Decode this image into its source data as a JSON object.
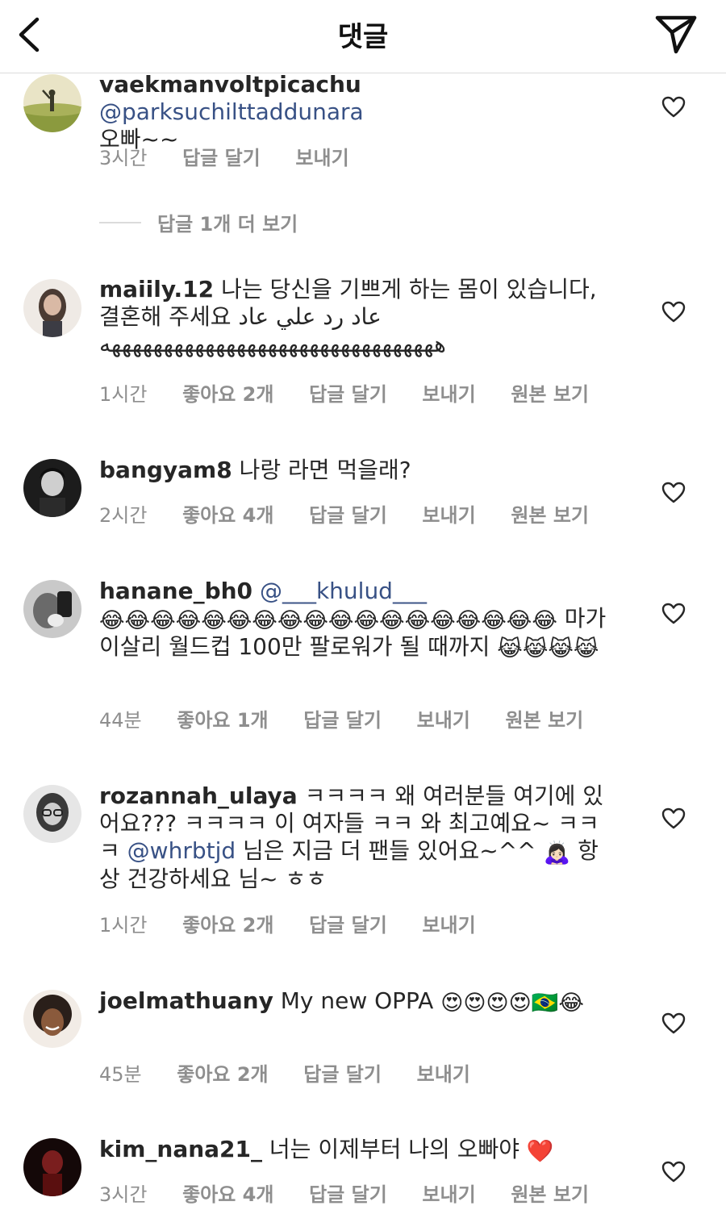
{
  "header": {
    "title": "댓글"
  },
  "comments": [
    {
      "username": "vaekmanvoltpicachu",
      "mention": "@parksuchilttaddunara",
      "text": "오빠~~",
      "meta": {
        "time": "3시간",
        "reply": "답글 달기",
        "send": "보내기"
      }
    },
    {
      "username": "maiily.12",
      "text": "나는 당신을 기쁘게 하는 몸이 있습니다, 결혼해 주세요 عاد رد علي عاد ههههههههههههههههههههههههههههههههه",
      "meta": {
        "time": "1시간",
        "likes": "좋아요 2개",
        "reply": "답글 달기",
        "send": "보내기",
        "original": "원본 보기"
      }
    },
    {
      "username": "bangyam8",
      "text": "나랑 라면 먹을래?",
      "meta": {
        "time": "2시간",
        "likes": "좋아요 4개",
        "reply": "답글 달기",
        "send": "보내기",
        "original": "원본 보기"
      }
    },
    {
      "username": "hanane_bh0",
      "mention": "@___khulud___",
      "emoji1": "😂😂😂😂😂😂😂😂😂😂😂😂😂😂😂😂😂😂",
      "text": "마가 이살리 월드컵 100만 팔로워가 될 때까지",
      "emoji2": "😹😹😹😹",
      "meta": {
        "time": "44분",
        "likes": "좋아요 1개",
        "reply": "답글 달기",
        "send": "보내기",
        "original": "원본 보기"
      }
    },
    {
      "username": "rozannah_ulaya",
      "text1": "ㅋㅋㅋㅋ 왜 여러분들 여기에 있어요??? ㅋㅋㅋㅋ 이 여자들 ㅋㅋ 와 최고예요~ ㅋㅋㅋ",
      "mention": "@whrbtjd",
      "text2": "님은 지금 더 팬들 있어요~^^",
      "emoji": "🙇🏻‍♀️",
      "text3": "항상 건강하세요 님~ ㅎㅎ",
      "meta": {
        "time": "1시간",
        "likes": "좋아요 2개",
        "reply": "답글 달기",
        "send": "보내기"
      }
    },
    {
      "username": "joelmathuany",
      "text": "My new OPPA",
      "emoji": "😍😍😍😍🇧🇷😂",
      "meta": {
        "time": "45분",
        "likes": "좋아요 2개",
        "reply": "답글 달기",
        "send": "보내기"
      }
    },
    {
      "username": "kim_nana21_",
      "text": "너는 이제부터 나의 오빠야",
      "emoji": "❤️",
      "meta": {
        "time": "3시간",
        "likes": "좋아요 4개",
        "reply": "답글 달기",
        "send": "보내기",
        "original": "원본 보기"
      }
    }
  ],
  "view_more_replies": "답글 1개 더 보기",
  "colors": {
    "text": "#262626",
    "meta": "#8e8e8e",
    "mention": "#385185",
    "divider": "#dbdbdb"
  },
  "icons": [
    "back-icon",
    "send-icon",
    "heart-outline-icon"
  ]
}
